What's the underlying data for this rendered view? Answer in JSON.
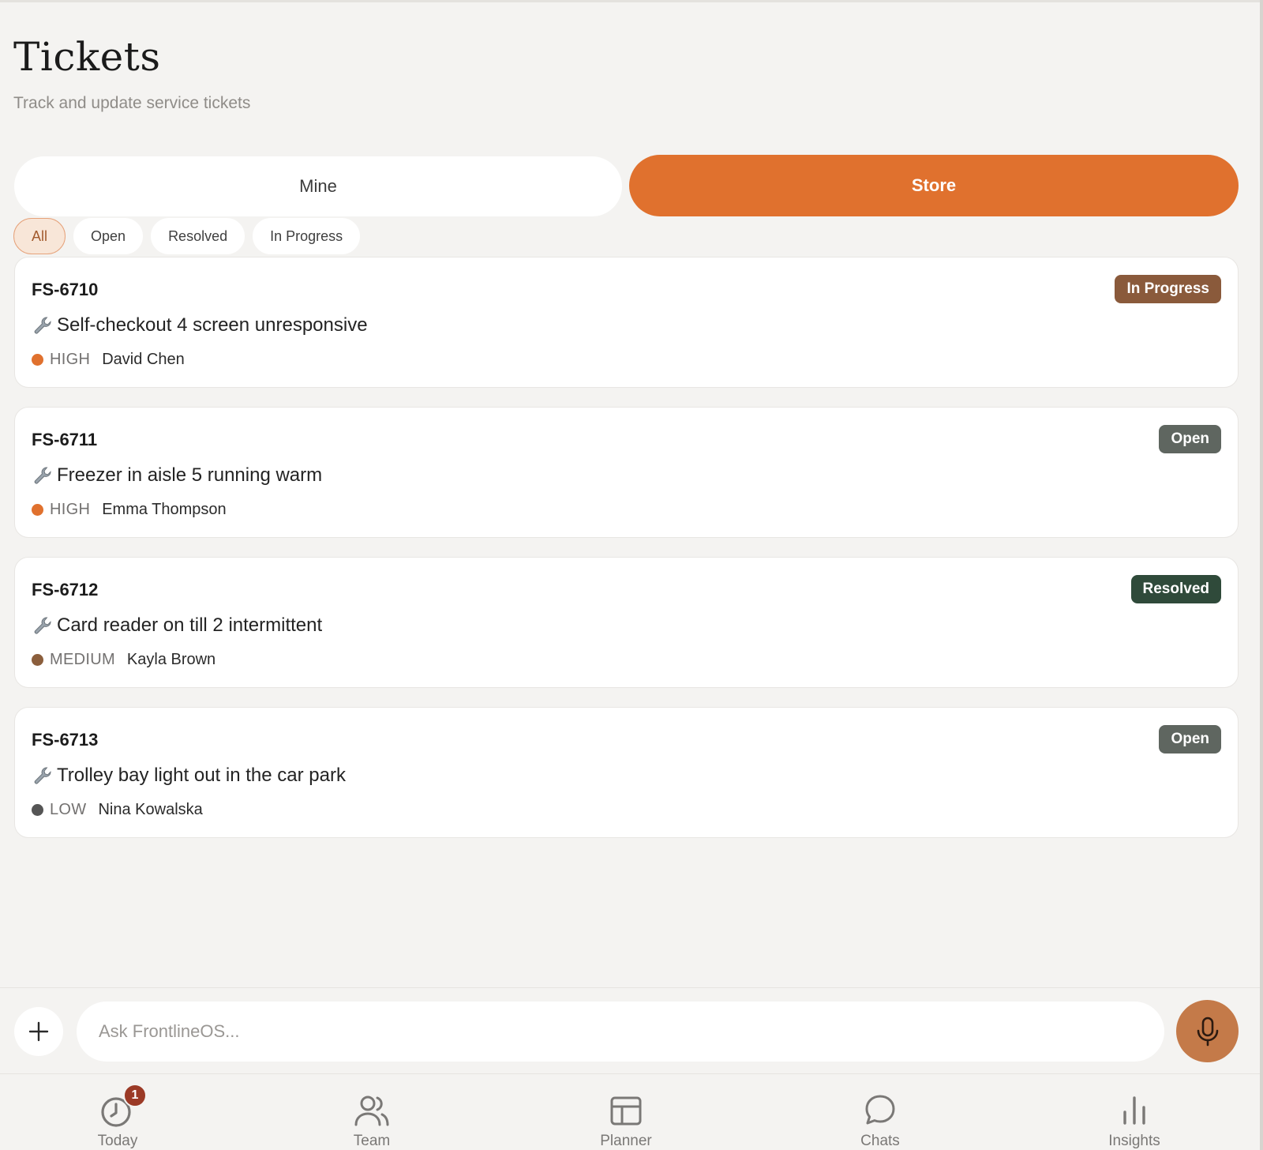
{
  "header": {
    "title": "Tickets",
    "subtitle": "Track and update service tickets"
  },
  "scope_toggle": {
    "options": [
      "Mine",
      "Store"
    ],
    "selected": "Store"
  },
  "filters": {
    "options": [
      "All",
      "Open",
      "Resolved",
      "In Progress"
    ],
    "selected": "All"
  },
  "tickets": [
    {
      "id": "FS-6710",
      "title": "Self-checkout 4 screen unresponsive",
      "priority": "HIGH",
      "priority_color": "#e0712e",
      "assignee": "David Chen",
      "status": "In Progress",
      "status_color": "#8a5a3b"
    },
    {
      "id": "FS-6711",
      "title": "Freezer in aisle 5 running warm",
      "priority": "HIGH",
      "priority_color": "#e0712e",
      "assignee": "Emma Thompson",
      "status": "Open",
      "status_color": "#5f6660"
    },
    {
      "id": "FS-6712",
      "title": "Card reader on till 2 intermittent",
      "priority": "MEDIUM",
      "priority_color": "#8b5e3c",
      "assignee": "Kayla Brown",
      "status": "Resolved",
      "status_color": "#2f4a3a"
    },
    {
      "id": "FS-6713",
      "title": "Trolley bay light out in the car park",
      "priority": "LOW",
      "priority_color": "#555555",
      "assignee": "Nina Kowalska",
      "status": "Open",
      "status_color": "#5f6660"
    }
  ],
  "ask": {
    "placeholder": "Ask FrontlineOS..."
  },
  "nav": {
    "items": [
      {
        "label": "Today",
        "icon": "clock-icon",
        "badge": "1"
      },
      {
        "label": "Team",
        "icon": "users-icon"
      },
      {
        "label": "Planner",
        "icon": "calendar-grid-icon"
      },
      {
        "label": "Chats",
        "icon": "chat-bubble-icon"
      },
      {
        "label": "Insights",
        "icon": "bar-chart-icon"
      }
    ]
  },
  "colors": {
    "accent": "#e0712e",
    "mic": "#c47a49",
    "background": "#f4f3f1"
  }
}
